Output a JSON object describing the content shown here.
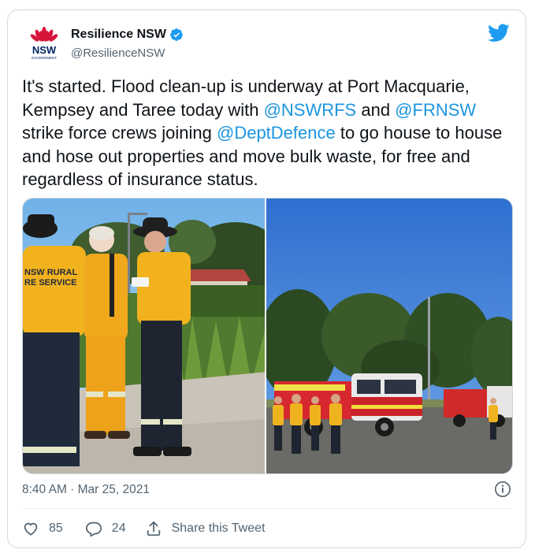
{
  "tweet": {
    "author": {
      "display_name": "Resilience NSW",
      "handle": "@ResilienceNSW",
      "logo_text": "NSW",
      "logo_subtext": "GOVERNMENT",
      "verified_icon": "verified-badge-icon"
    },
    "text": {
      "p1": "It's started. Flood clean-up is underway at Port Macquarie, Kempsey and Taree today with ",
      "mention1": "@NSWRFS",
      "p2": " and ",
      "mention2": "@FRNSW",
      "p3": " strike force crews joining ",
      "mention3": "@DeptDefence",
      "p4": " to go house to house and hose out properties and move bulk waste, for free and regardless of insurance status."
    },
    "photos": [
      {
        "description_icon": "rfs-volunteers-photo",
        "vest_text_1": "NSW RURAL",
        "vest_text_2": "RE SERVICE"
      },
      {
        "description_icon": "fire-trucks-photo"
      }
    ],
    "timestamp": "8:40 AM · Mar 25, 2021",
    "actions": {
      "likes": "85",
      "replies": "24",
      "share_label": "Share this Tweet"
    }
  },
  "colors": {
    "accent": "#1d9bf0",
    "mention": "#1b95e0",
    "text": "#0f1419",
    "secondary": "#536471",
    "nsw_red": "#d7153a"
  }
}
